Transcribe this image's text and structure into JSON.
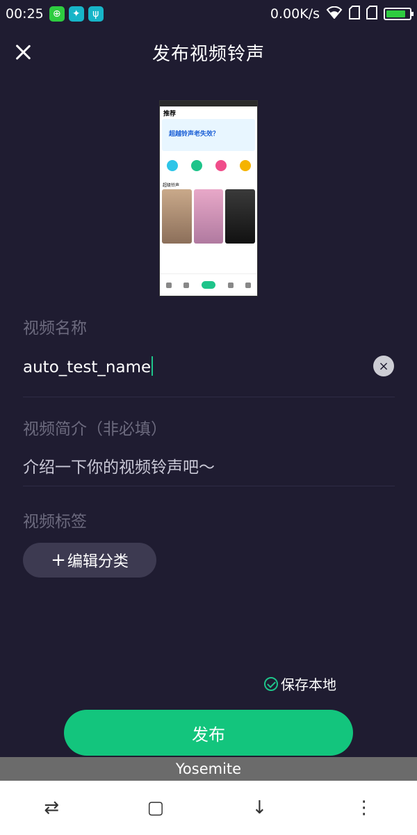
{
  "status_bar": {
    "time": "00:25",
    "net_speed": "0.00K/s",
    "icons": [
      "app-green-icon",
      "app-teal-icon",
      "usb-icon",
      "wifi-icon",
      "sim-icon",
      "sim-icon",
      "battery-icon"
    ],
    "battery_level": 0.85
  },
  "header": {
    "title": "发布视频铃声",
    "close_icon": "close-icon"
  },
  "form": {
    "name_label": "视频名称",
    "name_value": "auto_test_name",
    "clear_icon": "×",
    "intro_label": "视频简介（非必填）",
    "intro_placeholder": "介绍一下你的视频铃声吧～",
    "tag_label": "视频标签",
    "tag_button": "编辑分类",
    "tag_button_prefix": "+"
  },
  "save_local": {
    "label": "保存本地",
    "checked": true
  },
  "publish_button": "发布",
  "bottom_label": "Yosemite",
  "nav": {
    "switch": "⇄",
    "home": "▢",
    "down": "↓",
    "menu": "⋮"
  },
  "preview": {
    "tab_active": "推荐",
    "banner_text": "超越铃声老失效？",
    "section_video": "超级铃声",
    "colors": [
      "#2ec5e8",
      "#1ec48a",
      "#f04d8a",
      "#f5b300"
    ]
  }
}
